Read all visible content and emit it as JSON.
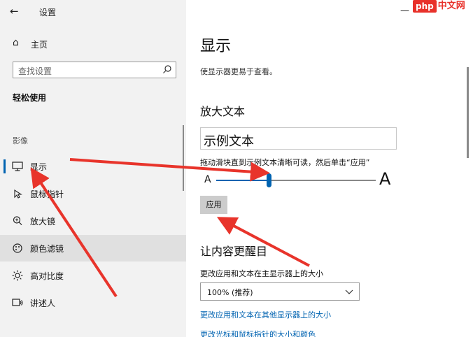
{
  "window": {
    "title": "设置",
    "minimize_glyph": "—"
  },
  "sidebar": {
    "home_label": "主页",
    "search_placeholder": "查找设置",
    "section_title": "轻松使用",
    "group_label": "影像",
    "items": [
      {
        "label": "显示",
        "icon": "monitor-icon",
        "active": true
      },
      {
        "label": "鼠标指针",
        "icon": "mouse-pointer-icon",
        "active": false
      },
      {
        "label": "放大镜",
        "icon": "magnifier-icon",
        "active": false
      },
      {
        "label": "颜色滤镜",
        "icon": "color-filter-icon",
        "active": false
      },
      {
        "label": "高对比度",
        "icon": "high-contrast-icon",
        "active": false
      },
      {
        "label": "讲述人",
        "icon": "narrator-icon",
        "active": false
      }
    ]
  },
  "main": {
    "title": "显示",
    "description": "使显示器更易于查看。",
    "enlarge_text": {
      "title": "放大文本",
      "sample_text": "示例文本",
      "hint": "拖动滑块直到示例文本清晰可读，然后单击“应用”",
      "small_a": "A",
      "large_a": "A",
      "slider_value": 0.33,
      "apply_label": "应用"
    },
    "make_everything_bigger": {
      "title": "让内容更醒目",
      "label": "更改应用和文本在主显示器上的大小",
      "selected_option": "100% (推荐)",
      "link_other_displays": "更改应用和文本在其他显示器上的大小",
      "link_partial": "更改光标和鼠标指针的大小和颜色"
    }
  },
  "watermark": {
    "badge": "php",
    "text": "中文网"
  },
  "colors": {
    "accent": "#0063b1",
    "arrow": "#e8342b",
    "sidebar_bg": "#f2f2f2"
  }
}
